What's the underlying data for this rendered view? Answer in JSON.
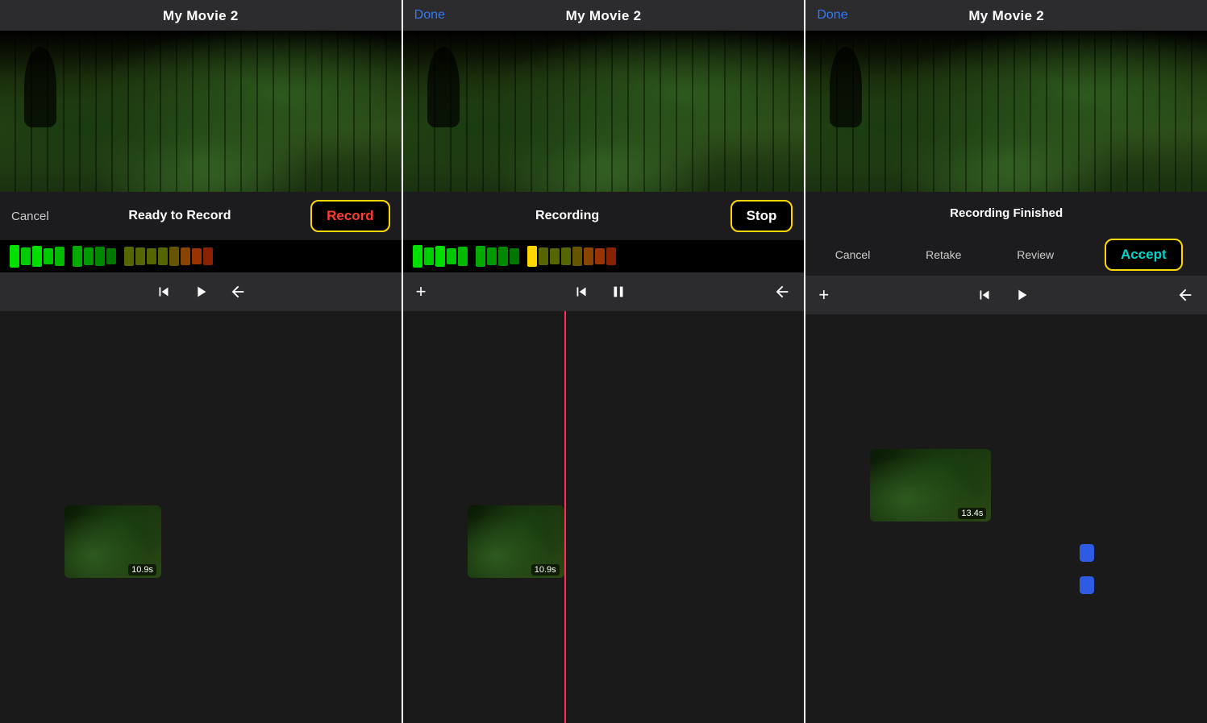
{
  "panel1": {
    "title": "My Movie 2",
    "header_left": "",
    "status": "Ready to Record",
    "record_btn": "Record",
    "clip_duration": "10.9s",
    "timeline_controls": {
      "rewind": "⏮",
      "play": "▶",
      "back": "↩"
    }
  },
  "panel2": {
    "title": "My Movie 2",
    "header_left": "Done",
    "status": "Recording",
    "stop_btn": "Stop",
    "clip_duration": "10.9s",
    "timeline_controls": {
      "plus": "+",
      "rewind": "⏮",
      "pause": "⏸",
      "back": "↩"
    }
  },
  "panel3": {
    "title": "My Movie 2",
    "header_left": "Done",
    "status": "Recording Finished",
    "cancel_btn": "Cancel",
    "retake_btn": "Retake",
    "review_btn": "Review",
    "accept_btn": "Accept",
    "clip_duration": "13.4s",
    "timeline_controls": {
      "plus": "+",
      "rewind": "⏮",
      "play": "▶",
      "back": "↩"
    }
  },
  "audio_meter": {
    "bars_green_bright": 5,
    "bars_green_mid": 4,
    "bars_green_dark": 6,
    "bar_yellow": 1,
    "bars_dark_olive": 4,
    "bars_dark_red": 3
  }
}
